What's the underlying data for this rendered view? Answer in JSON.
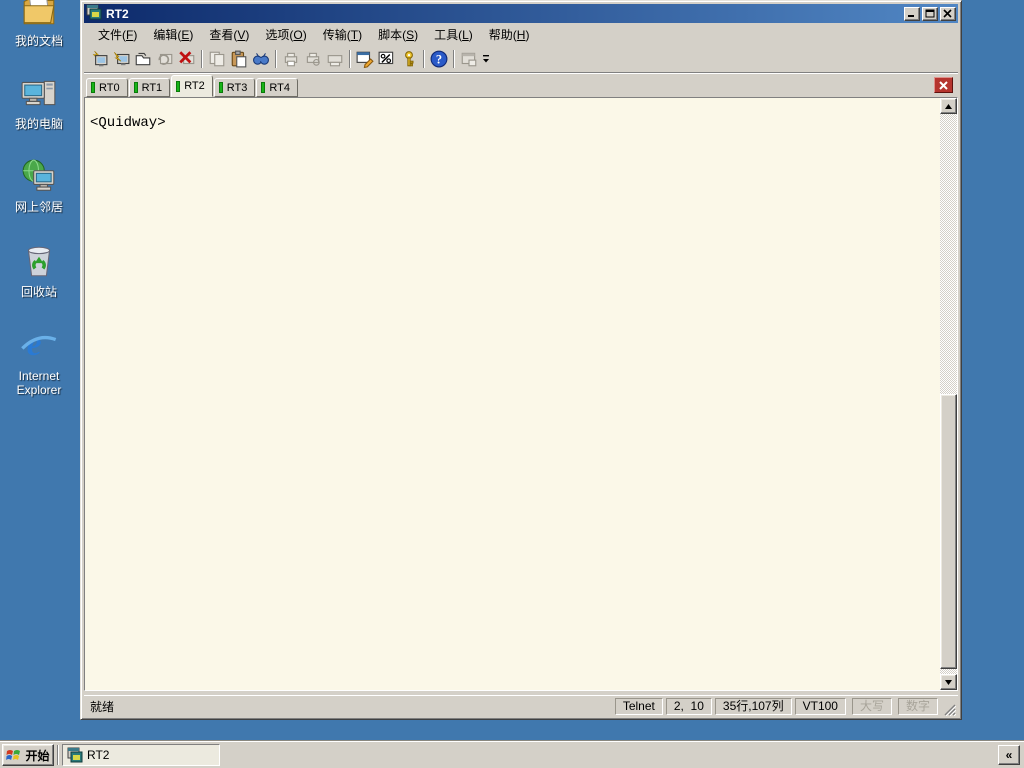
{
  "colors": {
    "desktop_blue": "#4078ae",
    "titlebar_gradient_left": "#0d2a6b",
    "titlebar_gradient_right": "#5187c4",
    "chrome_gray": "#d4d0c8",
    "terminal_background": "#fbf8e8",
    "tab_connected_green": "#18b418",
    "tabbar_close_red": "#b5342e"
  },
  "desktop": {
    "icons": [
      {
        "name": "my-documents",
        "label": "我的文档"
      },
      {
        "name": "my-computer",
        "label": "我的电脑"
      },
      {
        "name": "network-places",
        "label": "网上邻居"
      },
      {
        "name": "recycle-bin",
        "label": "回收站"
      },
      {
        "name": "internet-explorer",
        "label": "Internet Explorer"
      }
    ]
  },
  "window": {
    "title": "RT2",
    "menu": {
      "items": [
        {
          "pre": "文件(",
          "key": "F",
          "post": ")"
        },
        {
          "pre": "编辑(",
          "key": "E",
          "post": ")"
        },
        {
          "pre": "查看(",
          "key": "V",
          "post": ")"
        },
        {
          "pre": "选项(",
          "key": "O",
          "post": ")"
        },
        {
          "pre": "传输(",
          "key": "T",
          "post": ")"
        },
        {
          "pre": "脚本(",
          "key": "S",
          "post": ")"
        },
        {
          "pre": "工具(",
          "key": "L",
          "post": ")"
        },
        {
          "pre": "帮助(",
          "key": "H",
          "post": ")"
        }
      ]
    },
    "toolbar": {
      "icons": [
        "quick-connect",
        "connect",
        "connect-in-tab",
        "reconnect",
        "disconnect",
        "copy",
        "paste",
        "find",
        "print",
        "print-preview",
        "print-setup",
        "session-options",
        "keymap-editor",
        "key-agent",
        "help",
        "connect-bar",
        "toolbar-overflow"
      ]
    },
    "tabs": {
      "items": [
        {
          "label": "RT0",
          "active": false
        },
        {
          "label": "RT1",
          "active": false
        },
        {
          "label": "RT2",
          "active": true
        },
        {
          "label": "RT3",
          "active": false
        },
        {
          "label": "RT4",
          "active": false
        }
      ]
    },
    "terminal": {
      "prompt": "<Quidway>"
    },
    "statusbar": {
      "ready": "就绪",
      "protocol": "Telnet",
      "cursor_position": "2,  10",
      "terminal_size": "35行,107列",
      "emulation": "VT100",
      "caps_label": "大写",
      "num_label": "数字"
    }
  },
  "taskbar": {
    "start_label": "开始",
    "window_button": "RT2",
    "tray_collapse": "«"
  }
}
